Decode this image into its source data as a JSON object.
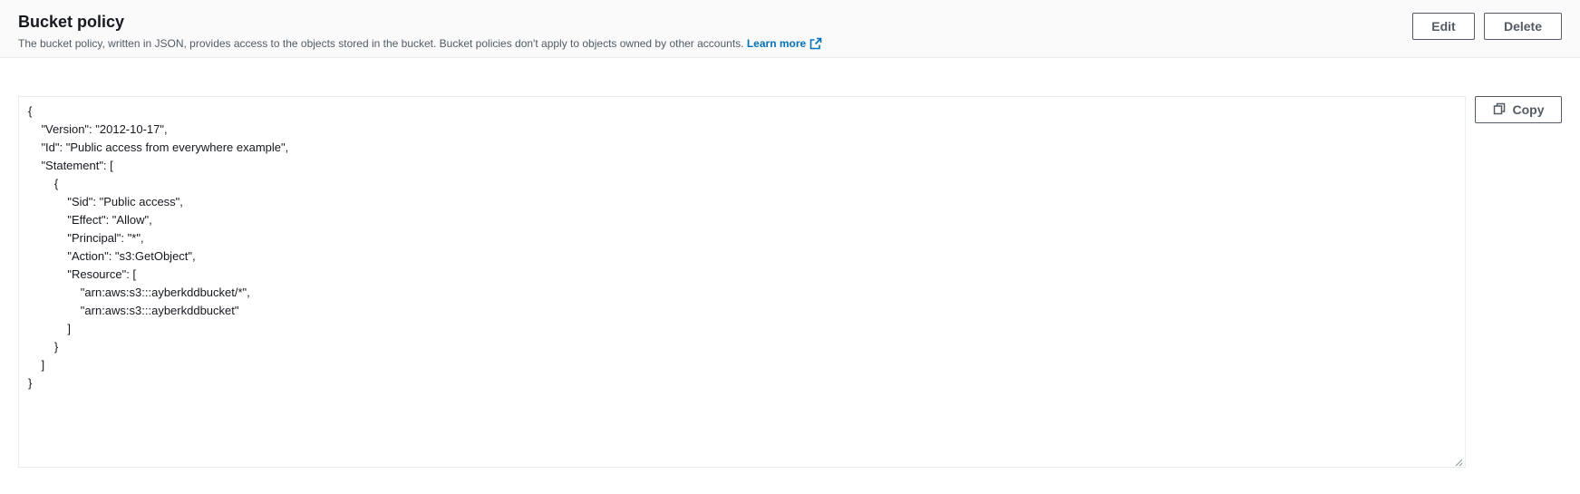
{
  "header": {
    "title": "Bucket policy",
    "description": "The bucket policy, written in JSON, provides access to the objects stored in the bucket. Bucket policies don't apply to objects owned by other accounts.",
    "learn_more": "Learn more"
  },
  "actions": {
    "edit_label": "Edit",
    "delete_label": "Delete",
    "copy_label": "Copy"
  },
  "policy": {
    "lines": [
      "{",
      "    \"Version\": \"2012-10-17\",",
      "    \"Id\": \"Public access from everywhere example\",",
      "    \"Statement\": [",
      "        {",
      "            \"Sid\": \"Public access\",",
      "            \"Effect\": \"Allow\",",
      "            \"Principal\": \"*\",",
      "            \"Action\": \"s3:GetObject\",",
      "            \"Resource\": [",
      "                \"arn:aws:s3:::ayberkddbucket/*\",",
      "                \"arn:aws:s3:::ayberkddbucket\"",
      "            ]",
      "        }",
      "    ]",
      "}"
    ]
  },
  "icons": {
    "external": "external-link-icon",
    "copy": "copy-icon",
    "resize": "resize-handle-icon"
  },
  "colors": {
    "link": "#0073bb",
    "text": "#16191f",
    "secondary_text": "#545b64",
    "header_bg": "#fafafa",
    "border": "#eaeded"
  }
}
